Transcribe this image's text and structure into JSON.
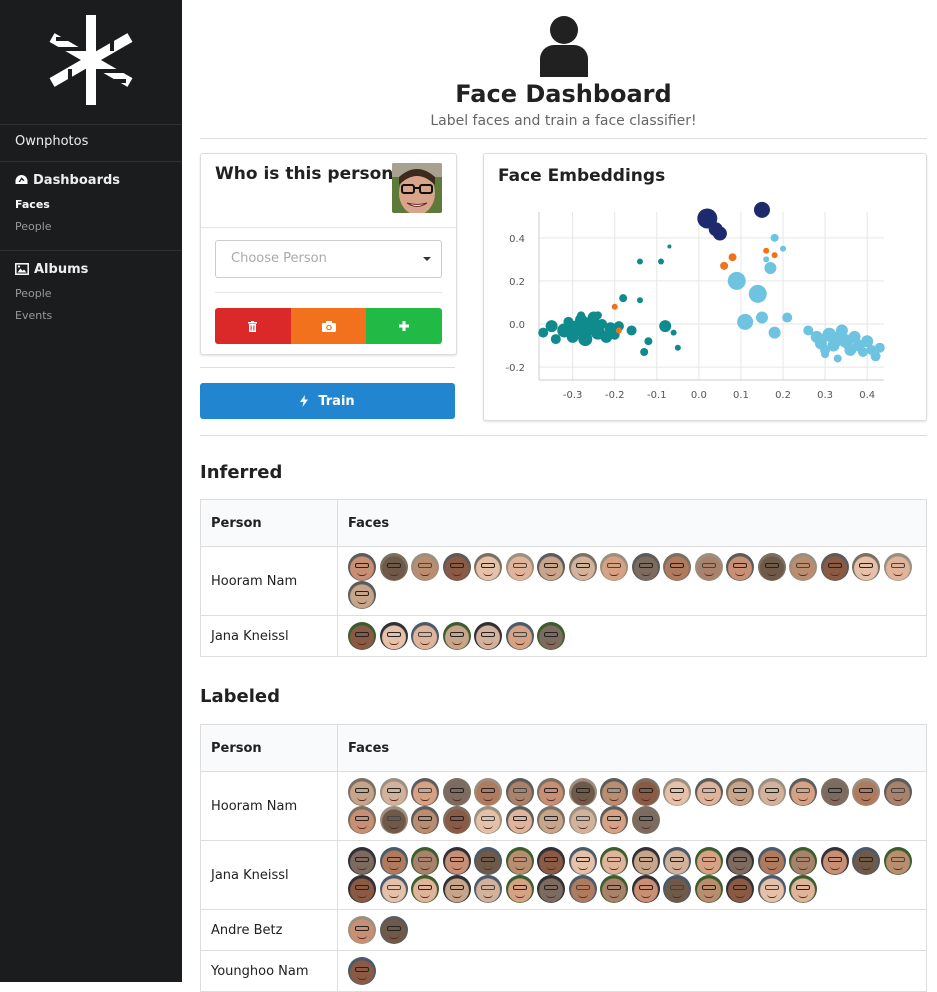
{
  "sidebar": {
    "brand": "Ownphotos",
    "dashboards": {
      "label": "Dashboards",
      "items": [
        "Faces",
        "People"
      ],
      "active": "Faces"
    },
    "albums": {
      "label": "Albums",
      "items": [
        "People",
        "Events"
      ]
    }
  },
  "header": {
    "title": "Face Dashboard",
    "subtitle": "Label faces and train a face classifier!"
  },
  "who_card": {
    "title": "Who is this person?",
    "select_placeholder": "Choose Person"
  },
  "buttons": {
    "train": "Train"
  },
  "colors": {
    "delete": "#db2828",
    "camera": "#f2711c",
    "add": "#21ba45",
    "train": "#2185d0"
  },
  "chart_data": {
    "type": "scatter",
    "title": "Face Embeddings",
    "xlim": [
      -0.38,
      0.44
    ],
    "ylim": [
      -0.26,
      0.52
    ],
    "xticks": [
      "-0.3",
      "-0.2",
      "-0.1",
      "0.0",
      "0.1",
      "0.2",
      "0.3",
      "0.4"
    ],
    "yticks": [
      "0.4",
      "0.2",
      "0.0",
      "-0.2"
    ],
    "grid": true,
    "points": [
      {
        "x": -0.37,
        "y": -0.04,
        "s": 5,
        "c": "#0f8b8d"
      },
      {
        "x": -0.35,
        "y": -0.01,
        "s": 6,
        "c": "#0f8b8d"
      },
      {
        "x": -0.34,
        "y": -0.07,
        "s": 5,
        "c": "#0f8b8d"
      },
      {
        "x": -0.32,
        "y": -0.03,
        "s": 7,
        "c": "#0f8b8d"
      },
      {
        "x": -0.31,
        "y": 0.01,
        "s": 5,
        "c": "#0f8b8d"
      },
      {
        "x": -0.3,
        "y": -0.06,
        "s": 6,
        "c": "#0f8b8d"
      },
      {
        "x": -0.29,
        "y": -0.02,
        "s": 8,
        "c": "#0f8b8d"
      },
      {
        "x": -0.28,
        "y": 0.02,
        "s": 6,
        "c": "#0f8b8d"
      },
      {
        "x": -0.27,
        "y": -0.07,
        "s": 7,
        "c": "#0f8b8d"
      },
      {
        "x": -0.26,
        "y": -0.01,
        "s": 9,
        "c": "#0f8b8d"
      },
      {
        "x": -0.25,
        "y": 0.03,
        "s": 6,
        "c": "#0f8b8d"
      },
      {
        "x": -0.24,
        "y": -0.04,
        "s": 7,
        "c": "#0f8b8d"
      },
      {
        "x": -0.23,
        "y": 0.0,
        "s": 5,
        "c": "#0f8b8d"
      },
      {
        "x": -0.22,
        "y": -0.06,
        "s": 6,
        "c": "#0f8b8d"
      },
      {
        "x": -0.21,
        "y": -0.02,
        "s": 6,
        "c": "#0f8b8d"
      },
      {
        "x": -0.2,
        "y": -0.05,
        "s": 5,
        "c": "#0f8b8d"
      },
      {
        "x": -0.19,
        "y": -0.01,
        "s": 5,
        "c": "#0f8b8d"
      },
      {
        "x": -0.28,
        "y": 0.04,
        "s": 4,
        "c": "#0f8b8d"
      },
      {
        "x": -0.24,
        "y": 0.04,
        "s": 4,
        "c": "#0f8b8d"
      },
      {
        "x": -0.18,
        "y": 0.12,
        "s": 4,
        "c": "#0f8b8d"
      },
      {
        "x": -0.14,
        "y": 0.11,
        "s": 3,
        "c": "#0f8b8d"
      },
      {
        "x": -0.16,
        "y": -0.03,
        "s": 5,
        "c": "#0f8b8d"
      },
      {
        "x": -0.13,
        "y": -0.13,
        "s": 4,
        "c": "#0f8b8d"
      },
      {
        "x": -0.12,
        "y": -0.08,
        "s": 4,
        "c": "#0f8b8d"
      },
      {
        "x": -0.08,
        "y": -0.01,
        "s": 6,
        "c": "#0f8b8d"
      },
      {
        "x": -0.05,
        "y": -0.11,
        "s": 3,
        "c": "#0f8b8d"
      },
      {
        "x": -0.06,
        "y": -0.04,
        "s": 3,
        "c": "#0f8b8d"
      },
      {
        "x": -0.14,
        "y": 0.29,
        "s": 3,
        "c": "#0f8b8d"
      },
      {
        "x": -0.09,
        "y": 0.29,
        "s": 3,
        "c": "#0f8b8d"
      },
      {
        "x": -0.07,
        "y": 0.36,
        "s": 2,
        "c": "#0f8b8d"
      },
      {
        "x": -0.2,
        "y": 0.08,
        "s": 3,
        "c": "#f2711c"
      },
      {
        "x": -0.19,
        "y": -0.03,
        "s": 3,
        "c": "#f2711c"
      },
      {
        "x": 0.02,
        "y": 0.49,
        "s": 10,
        "c": "#1e2a6e"
      },
      {
        "x": 0.04,
        "y": 0.44,
        "s": 7,
        "c": "#1e2a6e"
      },
      {
        "x": 0.05,
        "y": 0.42,
        "s": 7,
        "c": "#1e2a6e"
      },
      {
        "x": 0.15,
        "y": 0.53,
        "s": 8,
        "c": "#1e2a6e"
      },
      {
        "x": 0.06,
        "y": 0.27,
        "s": 4,
        "c": "#f2711c"
      },
      {
        "x": 0.08,
        "y": 0.31,
        "s": 4,
        "c": "#f2711c"
      },
      {
        "x": 0.16,
        "y": 0.34,
        "s": 3,
        "c": "#f2711c"
      },
      {
        "x": 0.18,
        "y": 0.32,
        "s": 3,
        "c": "#f2711c"
      },
      {
        "x": 0.09,
        "y": 0.2,
        "s": 9,
        "c": "#6ec3e0"
      },
      {
        "x": 0.14,
        "y": 0.14,
        "s": 9,
        "c": "#6ec3e0"
      },
      {
        "x": 0.11,
        "y": 0.01,
        "s": 8,
        "c": "#6ec3e0"
      },
      {
        "x": 0.15,
        "y": 0.03,
        "s": 6,
        "c": "#6ec3e0"
      },
      {
        "x": 0.18,
        "y": -0.04,
        "s": 6,
        "c": "#6ec3e0"
      },
      {
        "x": 0.17,
        "y": 0.26,
        "s": 6,
        "c": "#6ec3e0"
      },
      {
        "x": 0.18,
        "y": 0.4,
        "s": 4,
        "c": "#6ec3e0"
      },
      {
        "x": 0.2,
        "y": 0.35,
        "s": 3,
        "c": "#6ec3e0"
      },
      {
        "x": 0.16,
        "y": 0.3,
        "s": 3,
        "c": "#6ec3e0"
      },
      {
        "x": 0.21,
        "y": 0.03,
        "s": 5,
        "c": "#6ec3e0"
      },
      {
        "x": 0.26,
        "y": -0.03,
        "s": 5,
        "c": "#6ec3e0"
      },
      {
        "x": 0.28,
        "y": -0.06,
        "s": 6,
        "c": "#6ec3e0"
      },
      {
        "x": 0.29,
        "y": -0.09,
        "s": 6,
        "c": "#6ec3e0"
      },
      {
        "x": 0.3,
        "y": -0.12,
        "s": 5,
        "c": "#6ec3e0"
      },
      {
        "x": 0.31,
        "y": -0.05,
        "s": 7,
        "c": "#6ec3e0"
      },
      {
        "x": 0.32,
        "y": -0.1,
        "s": 6,
        "c": "#6ec3e0"
      },
      {
        "x": 0.33,
        "y": -0.07,
        "s": 7,
        "c": "#6ec3e0"
      },
      {
        "x": 0.34,
        "y": -0.03,
        "s": 6,
        "c": "#6ec3e0"
      },
      {
        "x": 0.35,
        "y": -0.08,
        "s": 7,
        "c": "#6ec3e0"
      },
      {
        "x": 0.36,
        "y": -0.12,
        "s": 6,
        "c": "#6ec3e0"
      },
      {
        "x": 0.37,
        "y": -0.06,
        "s": 6,
        "c": "#6ec3e0"
      },
      {
        "x": 0.38,
        "y": -0.1,
        "s": 6,
        "c": "#6ec3e0"
      },
      {
        "x": 0.39,
        "y": -0.13,
        "s": 5,
        "c": "#6ec3e0"
      },
      {
        "x": 0.4,
        "y": -0.08,
        "s": 6,
        "c": "#6ec3e0"
      },
      {
        "x": 0.41,
        "y": -0.12,
        "s": 5,
        "c": "#6ec3e0"
      },
      {
        "x": 0.42,
        "y": -0.15,
        "s": 5,
        "c": "#6ec3e0"
      },
      {
        "x": 0.43,
        "y": -0.11,
        "s": 5,
        "c": "#6ec3e0"
      },
      {
        "x": 0.3,
        "y": -0.14,
        "s": 4,
        "c": "#6ec3e0"
      },
      {
        "x": 0.33,
        "y": -0.16,
        "s": 4,
        "c": "#6ec3e0"
      }
    ]
  },
  "inferred": {
    "title": "Inferred",
    "columns": [
      "Person",
      "Faces"
    ],
    "rows": [
      {
        "person": "Hooram Nam",
        "faces": 19
      },
      {
        "person": "Jana Kneissl",
        "faces": 7
      }
    ]
  },
  "labeled": {
    "title": "Labeled",
    "columns": [
      "Person",
      "Faces"
    ],
    "rows": [
      {
        "person": "Hooram Nam",
        "faces": 28
      },
      {
        "person": "Jana Kneissl",
        "faces": 33
      },
      {
        "person": "Andre Betz",
        "faces": 2
      },
      {
        "person": "Younghoo Nam",
        "faces": 1
      }
    ]
  }
}
